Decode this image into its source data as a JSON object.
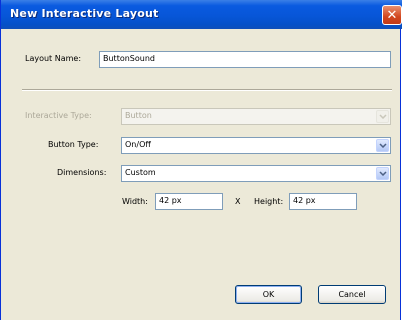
{
  "window": {
    "title": "New Interactive Layout"
  },
  "icons": {
    "close": "close-icon",
    "dropdown": "chevron-down-icon"
  },
  "form": {
    "layout_name_label": "Layout Name:",
    "layout_name_value": "ButtonSound",
    "interactive_type_label": "Interactive Type:",
    "interactive_type_value": "Button",
    "button_type_label": "Button Type:",
    "button_type_value": "On/Off",
    "dimensions_label": "Dimensions:",
    "dimensions_value": "Custom",
    "width_label": "Width:",
    "width_value": "42 px",
    "x_label": "X",
    "height_label": "Height:",
    "height_value": "42 px"
  },
  "buttons": {
    "ok": "OK",
    "cancel": "Cancel"
  }
}
